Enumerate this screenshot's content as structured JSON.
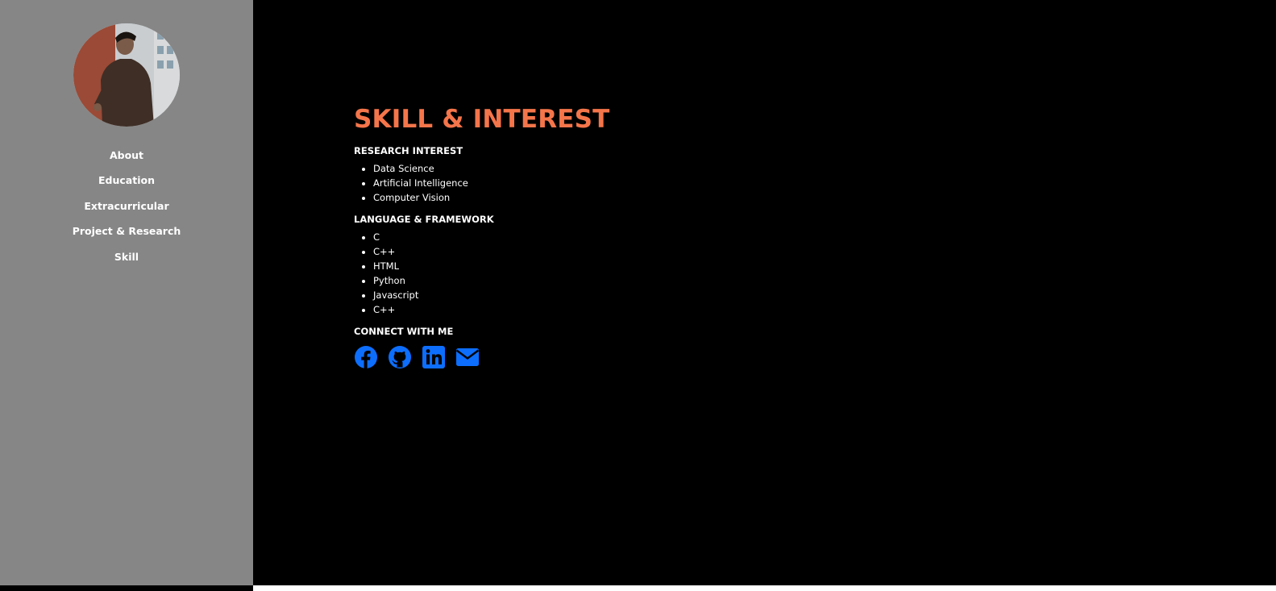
{
  "sidebar": {
    "avatar_alt": "profile photo",
    "nav": [
      {
        "label": "About"
      },
      {
        "label": "Education"
      },
      {
        "label": "Extracurricular"
      },
      {
        "label": "Project & Research"
      },
      {
        "label": "Skill"
      }
    ]
  },
  "main": {
    "title": "SKILL & INTEREST",
    "research": {
      "heading": "RESEARCH INTEREST",
      "items": [
        "Data Science",
        "Artificial Intelligence",
        "Computer Vision"
      ]
    },
    "languages": {
      "heading": "LANGUAGE & FRAMEWORK",
      "items": [
        "C",
        "C++",
        "HTML",
        "Python",
        "Javascript",
        "C++"
      ]
    },
    "connect": {
      "heading": "CONNECT WITH ME",
      "icons": [
        "facebook-icon",
        "github-icon",
        "linkedin-icon",
        "email-icon"
      ]
    }
  },
  "colors": {
    "sidebar_bg": "#868686",
    "main_bg": "#000000",
    "title": "#f5754a",
    "icon": "#0d6efd",
    "text": "#ffffff"
  }
}
